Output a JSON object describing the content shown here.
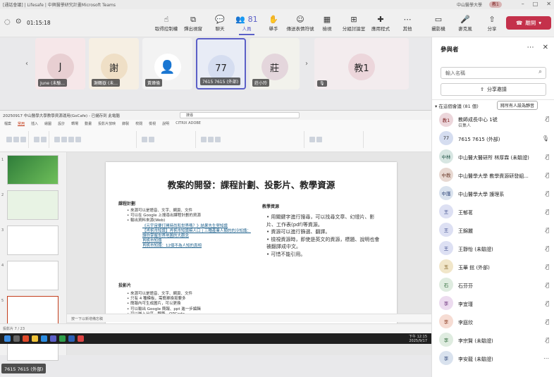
{
  "window": {
    "title": "[通話會議] | Lifesafe | 中興醫學研究計畫Microsoft Teams",
    "org": "中山醫學大學",
    "user_badge": "教1"
  },
  "toolbar": {
    "timer": "01:15:18",
    "items": [
      {
        "label": "取得控制權",
        "icon": "pointer-icon"
      },
      {
        "label": "彈出視窗",
        "icon": "popout-icon"
      },
      {
        "label": "聊天",
        "icon": "chat-icon"
      },
      {
        "label": "人員",
        "icon": "people-icon",
        "count": "81"
      },
      {
        "label": "舉手",
        "icon": "hand-icon"
      },
      {
        "label": "傳送表情符號",
        "icon": "emoji-icon"
      },
      {
        "label": "檢視",
        "icon": "view-icon"
      },
      {
        "label": "分組討論室",
        "icon": "rooms-icon"
      },
      {
        "label": "應用程式",
        "icon": "apps-icon"
      },
      {
        "label": "其他",
        "icon": "more-icon"
      },
      {
        "label": "攝影機",
        "icon": "camera-icon"
      },
      {
        "label": "麥克風",
        "icon": "mic-icon"
      },
      {
        "label": "分享",
        "icon": "share-icon"
      }
    ],
    "leave_label": "離開"
  },
  "participants_strip": [
    {
      "initial": "J",
      "name": "June (未驗...",
      "bg": "#f6e7e9",
      "av": "#e8cfd2"
    },
    {
      "initial": "謝",
      "name": "謝鶴嶽 (未...",
      "bg": "#f6efe3",
      "av": "#efdfc6"
    },
    {
      "initial": "",
      "name": "黃瑋倫",
      "bg": "#f3f3f3",
      "av": "#ffffff"
    },
    {
      "initial": "77",
      "name": "7615 7615 (外部)",
      "bg": "#e8ecf6",
      "av": "#d5ddf0"
    },
    {
      "initial": "莊",
      "name": "莊小玲",
      "bg": "#f2f2ec",
      "av": "#e4d6dc"
    },
    {
      "initial": "教1",
      "name": "",
      "bg": "#f3ecee",
      "av": "#ecd6db"
    }
  ],
  "ppt": {
    "window_title": "20250917 中山醫學大學教學資源運用(GoCafe) - 已儲存到 此電腦",
    "search": "搜尋",
    "tabs": [
      "檔案",
      "常用",
      "插入",
      "繪圖",
      "設計",
      "轉場",
      "動畫",
      "投影片放映",
      "錄製",
      "校閱",
      "檢視",
      "說明",
      "CITRIX ADOBE"
    ],
    "notes_placeholder": "按一下以新增備忘稿",
    "status": "投影片 7 / 23",
    "slide_title": "教案的開發：課程計劃、投影片、教學資源",
    "sec1": "課程計劃",
    "sec1_items": [
      "來源可以是語音、文字、網頁、文件",
      "可以在 Google 上搜尋出課程計劃的資源",
      "輸出資料來源(Web)"
    ],
    "sec1_links": [
      "《元宇宙要打開時尚和世界嗎？》結果先生勞知識",
      "【肖帆市知識】肖帆市知識嘛人口 | 三種產業人類的的冷知識：讓你掌握世界地圖的大觀念",
      "肖帆市知識",
      "肖帆市知識：12個不為人知的真相"
    ],
    "sec2": "投影片",
    "sec2_items": [
      "來源可以是語音、文字、網頁、文件",
      "只有 4 種模板，需簡單換寫要多",
      "簡報內可生成圖片，可以更換",
      "可以輸出 Google 簡報、ppt 進一步編輯",
      "可以嵌入分享，鋼筆、QRCode"
    ],
    "sec3": "教學資源",
    "sec3_items": [
      "用關鍵字進行搜尋，可以找尋文章、幻燈片、影片、工作表(pdf)等資源。",
      "資源可以進行篩選、翻譯。",
      "檢視資源時，即使是英文的資源，標題、說明也會被翻譯成中文。",
      "可惜不能引用。"
    ],
    "thumbnails": [
      "1",
      "2",
      "3",
      "4",
      "5",
      "6"
    ]
  },
  "taskbar": {
    "time": "下午 12:15",
    "date": "2025/9/17"
  },
  "bottom_name": "7615 7615 (外部)",
  "panel": {
    "title": "參與者",
    "search_placeholder": "輸入名稱",
    "share_invite": "分享邀請",
    "section": "在這個會議 (81 個)",
    "mute_all": "將所有人設為靜音",
    "people": [
      {
        "initial": "教1",
        "name": "教師成長中心 1號",
        "sub": "召集人",
        "bg": "#ecd6db",
        "fg": "#7a1f1f",
        "mic": "muted"
      },
      {
        "initial": "77",
        "name": "7615 7615 (外部)",
        "sub": "",
        "bg": "#d5ddf0",
        "fg": "#222",
        "mic": "on"
      },
      {
        "initial": "中林",
        "name": "中山醫大醫研所 林厚霖 (未驗證)",
        "sub": "",
        "bg": "#d7e6e2",
        "fg": "#2b5c4f",
        "mic": "muted"
      },
      {
        "initial": "中教",
        "name": "中山醫學大學 教學資源研發組...",
        "sub": "",
        "bg": "#e8d9d2",
        "fg": "#6a3a2a",
        "mic": "muted"
      },
      {
        "initial": "中護",
        "name": "中山醫學大學 護理系",
        "sub": "",
        "bg": "#d9e2ee",
        "fg": "#30477a",
        "mic": "muted"
      },
      {
        "initial": "王",
        "name": "王郁茗",
        "sub": "",
        "bg": "#dde0f3",
        "fg": "#3b4a8a",
        "mic": "muted"
      },
      {
        "initial": "王",
        "name": "王錦麗",
        "sub": "",
        "bg": "#dde0f3",
        "fg": "#3b4a8a",
        "mic": "muted"
      },
      {
        "initial": "王",
        "name": "王靜怡 (未驗證)",
        "sub": "",
        "bg": "#dde0f3",
        "fg": "#3b4a8a",
        "mic": "muted"
      },
      {
        "initial": "玉",
        "name": "玉華 鉉 (外部)",
        "sub": "",
        "bg": "#f1e6c9",
        "fg": "#7a5a1a",
        "mic": "muted"
      },
      {
        "initial": "石",
        "name": "石芬芬",
        "sub": "",
        "bg": "#dfece0",
        "fg": "#2f6a3a",
        "mic": "muted"
      },
      {
        "initial": "李",
        "name": "李宜瑾",
        "sub": "",
        "bg": "#ecdbef",
        "fg": "#6a2f7a",
        "mic": "muted"
      },
      {
        "initial": "李",
        "name": "李庭欣",
        "sub": "",
        "bg": "#f6dcd3",
        "fg": "#8a3a1f",
        "mic": "muted"
      },
      {
        "initial": "李",
        "name": "李宗賢 (未驗證)",
        "sub": "",
        "bg": "#dfece0",
        "fg": "#2f6a3a",
        "mic": "muted"
      },
      {
        "initial": "李",
        "name": "李安龍 (未驗證)",
        "sub": "",
        "bg": "#d9e2ee",
        "fg": "#30477a",
        "mic": "more"
      }
    ]
  }
}
